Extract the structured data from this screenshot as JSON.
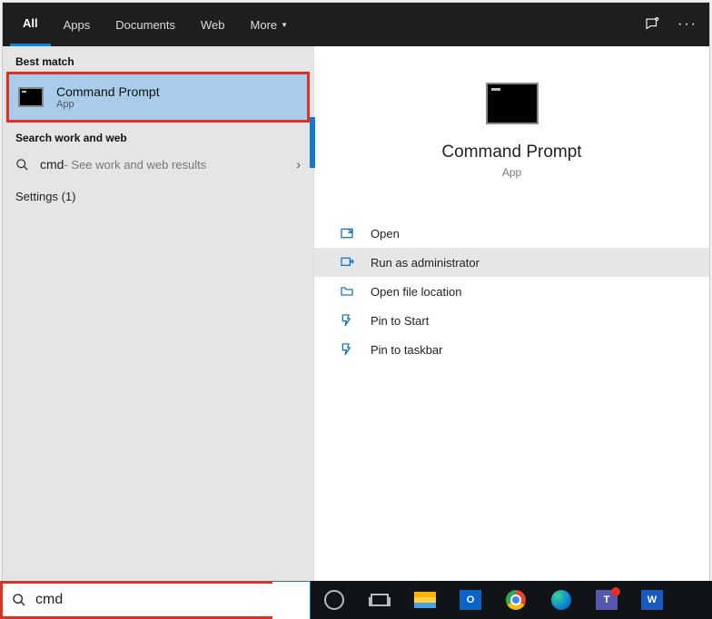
{
  "tabs": {
    "all": "All",
    "apps": "Apps",
    "documents": "Documents",
    "web": "Web",
    "more": "More"
  },
  "left": {
    "best_match_heading": "Best match",
    "best_match": {
      "title": "Command Prompt",
      "subtitle": "App"
    },
    "search_heading": "Search work and web",
    "search_row": {
      "query": "cmd",
      "suffix": " - See work and web results"
    },
    "settings_row": "Settings (1)"
  },
  "right": {
    "title": "Command Prompt",
    "subtitle": "App",
    "actions": {
      "open": "Open",
      "run_admin": "Run as administrator",
      "open_loc": "Open file location",
      "pin_start": "Pin to Start",
      "pin_taskbar": "Pin to taskbar"
    }
  },
  "search": {
    "query": "cmd"
  },
  "taskbar": {
    "outlook": "O",
    "teams": "T",
    "word": "W"
  }
}
